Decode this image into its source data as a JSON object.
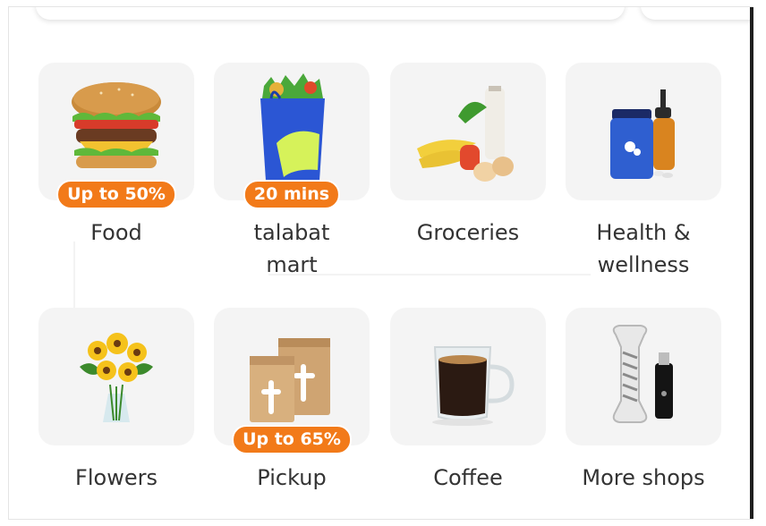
{
  "categories": [
    {
      "name": "food",
      "label": "Food",
      "badge": "Up to 50%",
      "icon": "burger-icon"
    },
    {
      "name": "talabat-mart",
      "label": "talabat mart",
      "badge": "20 mins",
      "icon": "grocery-bag-icon"
    },
    {
      "name": "groceries",
      "label": "Groceries",
      "badge": "",
      "icon": "produce-icon"
    },
    {
      "name": "health-wellness",
      "label": "Health & wellness",
      "badge": "",
      "icon": "supplements-icon"
    },
    {
      "name": "flowers",
      "label": "Flowers",
      "badge": "",
      "icon": "sunflower-bouquet-icon"
    },
    {
      "name": "pickup",
      "label": "Pickup",
      "badge": "Up to 65%",
      "icon": "paper-bags-icon"
    },
    {
      "name": "coffee",
      "label": "Coffee",
      "badge": "",
      "icon": "coffee-cup-icon"
    },
    {
      "name": "more-shops",
      "label": "More shops",
      "badge": "",
      "icon": "pet-toy-icon"
    }
  ],
  "colors": {
    "badge": "#f27a19",
    "tile_bg": "#f4f4f4",
    "label_text": "#333333"
  }
}
